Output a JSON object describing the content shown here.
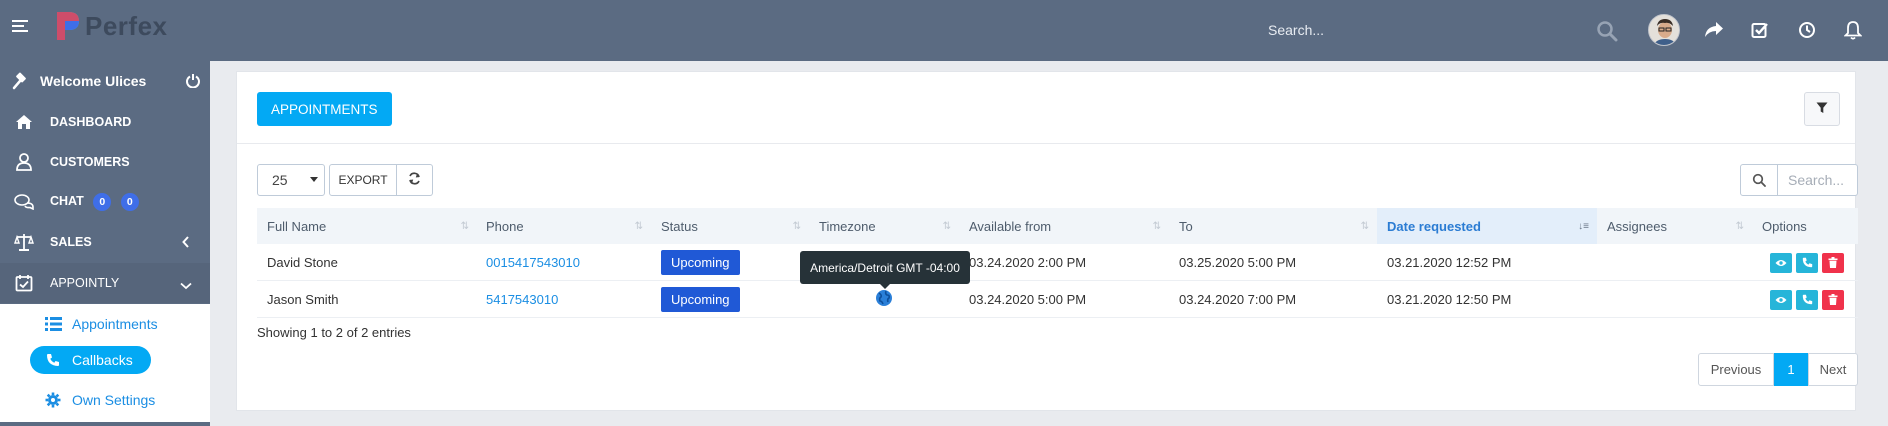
{
  "header": {
    "app_name": "Perfex",
    "search_placeholder": "Search..."
  },
  "sidebar": {
    "welcome": "Welcome Ulices",
    "items": [
      {
        "label": "DASHBOARD",
        "icon": "home-icon"
      },
      {
        "label": "CUSTOMERS",
        "icon": "user-icon"
      },
      {
        "label": "CHAT",
        "icon": "chat-icon",
        "badges": [
          "0",
          "0"
        ]
      },
      {
        "label": "SALES",
        "icon": "balance-scale-icon"
      },
      {
        "label": "APPOINTLY",
        "icon": "calendar-check-icon"
      }
    ],
    "subitems": [
      {
        "label": "Appointments",
        "icon": "list-icon"
      },
      {
        "label": "Callbacks",
        "icon": "phone-icon",
        "active": true
      },
      {
        "label": "Own Settings",
        "icon": "gear-icon"
      }
    ]
  },
  "panel": {
    "title_button": "APPOINTMENTS",
    "page_length": "25",
    "export_label": "EXPORT",
    "search_placeholder": "Search...",
    "columns": [
      "Full Name",
      "Phone",
      "Status",
      "Timezone",
      "Available from",
      "To",
      "Date requested",
      "Assignees",
      "Options"
    ],
    "rows": [
      {
        "name": "David Stone",
        "phone": "0015417543010",
        "status": "Upcoming",
        "available_from": "03.24.2020 2:00 PM",
        "to": "03.25.2020 5:00 PM",
        "date_requested": "03.21.2020 12:52 PM",
        "assignees": ""
      },
      {
        "name": "Jason Smith",
        "phone": "5417543010",
        "status": "Upcoming",
        "available_from": "03.24.2020 5:00 PM",
        "to": "03.24.2020 7:00 PM",
        "date_requested": "03.21.2020 12:50 PM",
        "assignees": ""
      }
    ],
    "tooltip": "America/Detroit GMT -04:00",
    "info": "Showing 1 to 2 of 2 entries",
    "pagination": {
      "previous": "Previous",
      "current": "1",
      "next": "Next"
    }
  },
  "colors": {
    "sidebar_bg": "#5b6b82",
    "accent": "#03a9f4",
    "status_badge": "#2059d6",
    "view_btn": "#26b5d9",
    "call_btn": "#26b5d9",
    "delete_btn": "#f0324b"
  }
}
